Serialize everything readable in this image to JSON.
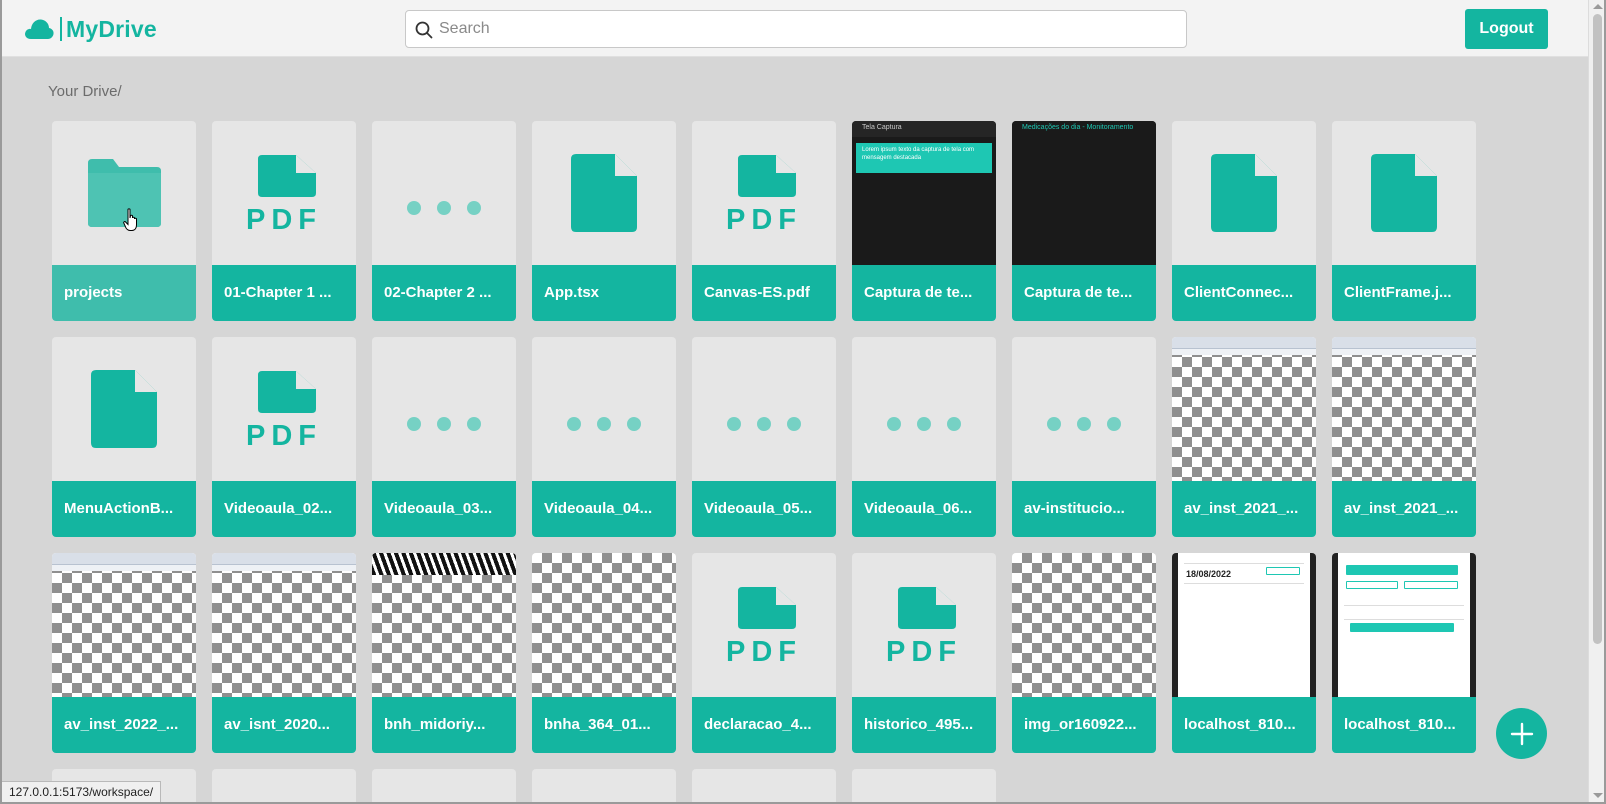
{
  "app": {
    "name": "MyDrive"
  },
  "header": {
    "search_placeholder": "Search",
    "logout_label": "Logout"
  },
  "breadcrumb": "Your Drive/",
  "colors": {
    "accent": "#14b5a0",
    "accent_light": "#76d1c4",
    "page_bg": "#d6d6d6"
  },
  "files": [
    {
      "name": "projects",
      "type": "folder"
    },
    {
      "name": "01-Chapter 1 ...",
      "type": "pdf"
    },
    {
      "name": "02-Chapter 2 ...",
      "type": "other"
    },
    {
      "name": "App.tsx",
      "type": "file"
    },
    {
      "name": "Canvas-ES.pdf",
      "type": "pdf"
    },
    {
      "name": "Captura de te...",
      "type": "image-dark-teal"
    },
    {
      "name": "Captura de te...",
      "type": "image-dark"
    },
    {
      "name": "ClientConnec...",
      "type": "file"
    },
    {
      "name": "ClientFrame.j...",
      "type": "file"
    },
    {
      "name": "MenuActionB...",
      "type": "file"
    },
    {
      "name": "Videoaula_02...",
      "type": "pdf"
    },
    {
      "name": "Videoaula_03...",
      "type": "other"
    },
    {
      "name": "Videoaula_04...",
      "type": "other"
    },
    {
      "name": "Videoaula_05...",
      "type": "other"
    },
    {
      "name": "Videoaula_06...",
      "type": "other"
    },
    {
      "name": "av-institucio...",
      "type": "other"
    },
    {
      "name": "av_inst_2021_...",
      "type": "image-screenshot"
    },
    {
      "name": "av_inst_2021_...",
      "type": "image-screenshot"
    },
    {
      "name": "av_inst_2022_...",
      "type": "image-screenshot"
    },
    {
      "name": "av_isnt_2020...",
      "type": "image-screenshot"
    },
    {
      "name": "bnh_midoriy...",
      "type": "image-manga"
    },
    {
      "name": "bnha_364_01...",
      "type": "image-checker"
    },
    {
      "name": "declaracao_4...",
      "type": "pdf"
    },
    {
      "name": "historico_495...",
      "type": "pdf"
    },
    {
      "name": "img_or160922...",
      "type": "image-checker"
    },
    {
      "name": "localhost_810...",
      "type": "image-phone-a"
    },
    {
      "name": "localhost_810...",
      "type": "image-phone-b"
    }
  ],
  "thumb_text": {
    "dark_title": "Tela Captura",
    "dark_teal_text": "Lorem ipsum texto da captura de tela com mensagem destacada",
    "dark2_title": "Medicações do dia - Monitoramento",
    "phone_date": "18/08/2022"
  },
  "fab_label": "+",
  "status_url": "127.0.0.1:5173/workspace/"
}
